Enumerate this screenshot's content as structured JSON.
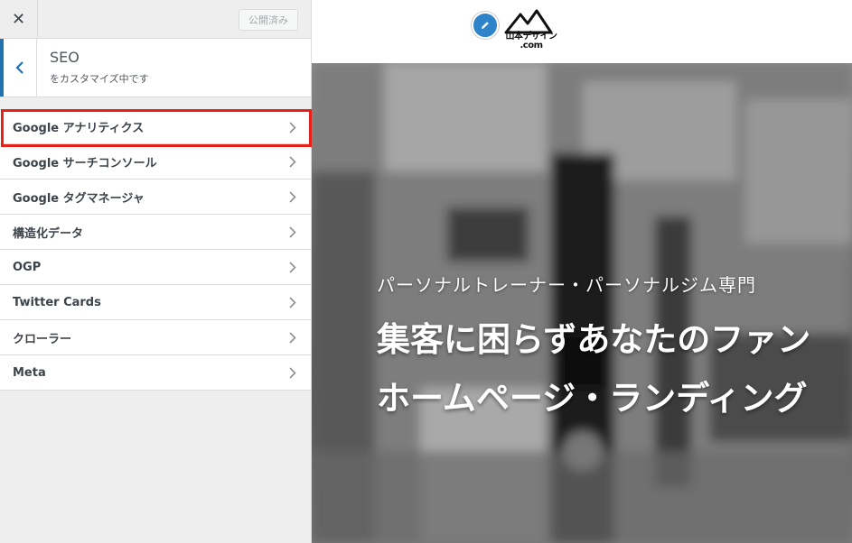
{
  "topbar": {
    "close_glyph": "✕",
    "publish_label": "公開済み"
  },
  "section": {
    "title": "SEO",
    "subtitle": "をカスタマイズ中です"
  },
  "menu": [
    {
      "label": "Google アナリティクス",
      "highlighted": true
    },
    {
      "label": "Google サーチコンソール"
    },
    {
      "label": "Google タグマネージャ"
    },
    {
      "label": "構造化データ"
    },
    {
      "label": "OGP"
    },
    {
      "label": "Twitter Cards"
    },
    {
      "label": "クローラー"
    },
    {
      "label": "Meta"
    }
  ],
  "preview": {
    "logo_text_top": "山本デザイン",
    "logo_text_bottom": ".com",
    "hero_eyebrow": "パーソナルトレーナー・パーソナルジム専門",
    "hero_line1": "集客に困らずあなたのファン",
    "hero_line2": "ホームページ・ランディング"
  },
  "colors": {
    "accent": "#2271b1",
    "highlight": "#e8201a",
    "pencil": "#2e83c9"
  },
  "icons": [
    "close-icon",
    "back-chevron-icon",
    "chevron-right-icon",
    "pencil-icon",
    "mountain-logo-icon"
  ]
}
